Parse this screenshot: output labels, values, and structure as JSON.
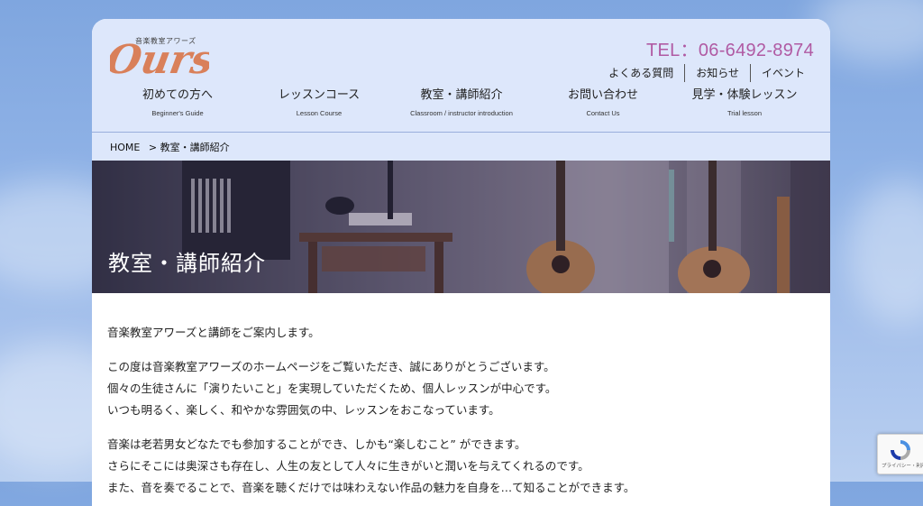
{
  "header": {
    "logo_text": "Ours",
    "logo_sub": "音楽教室アワーズ",
    "tel": "TEL：06-6492-8974",
    "util_links": [
      "よくある質問",
      "お知らせ",
      "イベント"
    ]
  },
  "nav": [
    {
      "jp": "初めての方へ",
      "en": "Beginner's Guide"
    },
    {
      "jp": "レッスンコース",
      "en": "Lesson Course"
    },
    {
      "jp": "教室・講師紹介",
      "en": "Classroom / instructor introduction"
    },
    {
      "jp": "お問い合わせ",
      "en": "Contact Us"
    },
    {
      "jp": "見学・体験レッスン",
      "en": "Trial lesson"
    }
  ],
  "breadcrumb": {
    "home": "HOME",
    "current": "> 教室・講師紹介"
  },
  "hero": {
    "title": "教室・講師紹介"
  },
  "content": {
    "p1": "音楽教室アワーズと講師をご案内します。",
    "p2_l1": "この度は音楽教室アワーズのホームページをご覧いただき、誠にありがとうございます。",
    "p2_l2": "個々の生徒さんに「演りたいこと」を実現していただくため、個人レッスンが中心です。",
    "p2_l3": "いつも明るく、楽しく、和やかな雰囲気の中、レッスンをおこなっています。",
    "p3_l1": "音楽は老若男女どなたでも参加することができ、しかも“楽しむこと” ができます。",
    "p3_l2": "さらにそこには奥深さも存在し、人生の友として人々に生きがいと潤いを与えてくれるのです。",
    "p3_l3": "また、音を奏でることで、音楽を聴くだけでは味わえない作品の魅力を自身を…て知ることができます。"
  },
  "recaptcha": {
    "text": "プライバシー・利用規約"
  },
  "colors": {
    "accent": "#b05aa3",
    "logo": "#d9805a",
    "header_bg": "#dde7fb"
  }
}
